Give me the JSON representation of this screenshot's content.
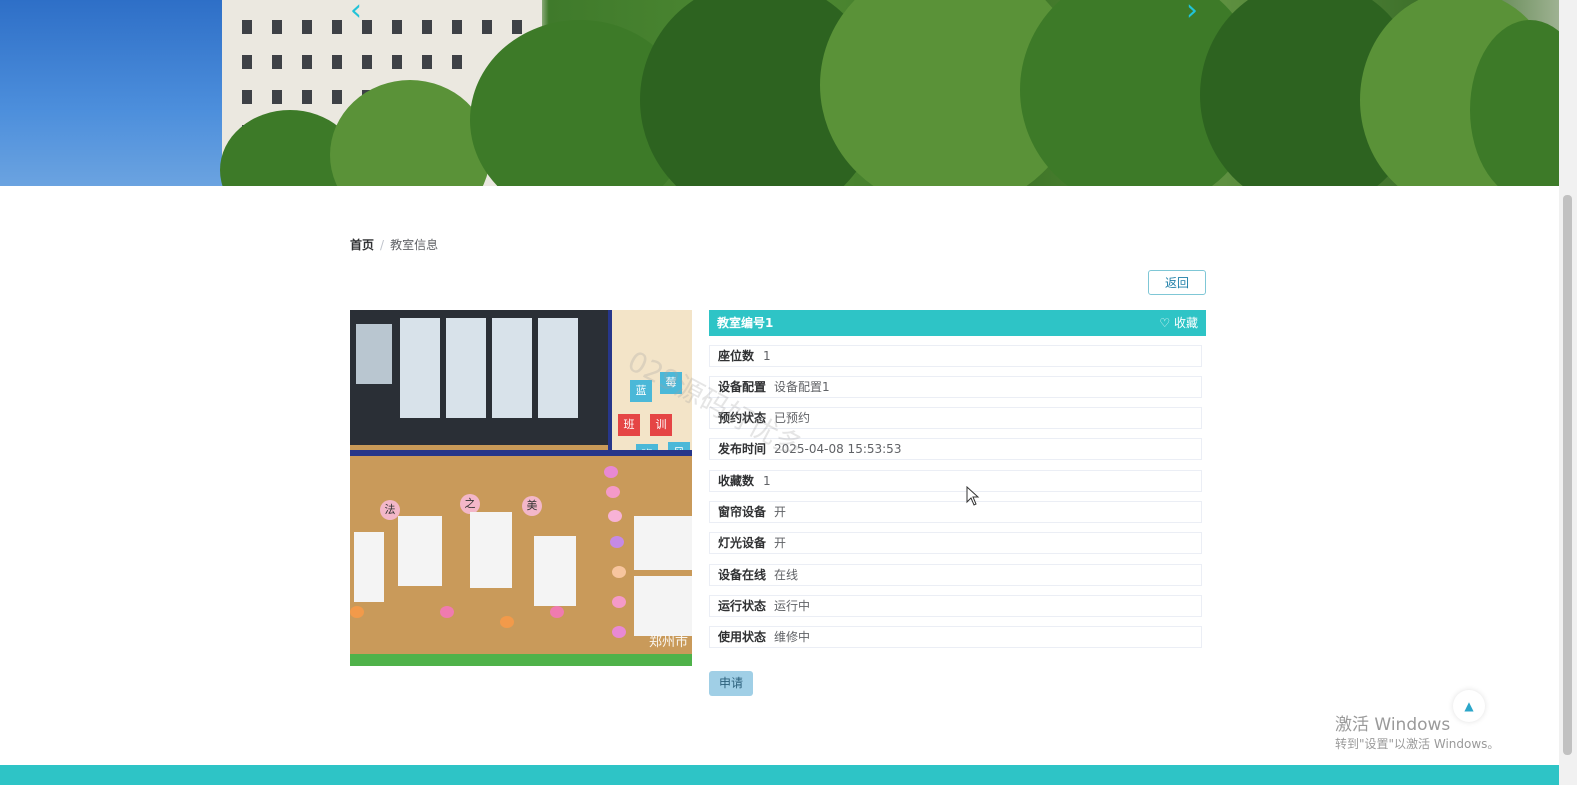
{
  "hero": {
    "prev_icon": "chevron-left-icon",
    "next_icon": "chevron-right-icon"
  },
  "breadcrumb": {
    "home": "首页",
    "separator": "/",
    "current": "教室信息"
  },
  "back_button": "返回",
  "detail": {
    "title": "教室编号1",
    "favorite_icon": "heart-outline-icon",
    "favorite_label": "收藏",
    "rows": [
      {
        "label": "座位数",
        "value": "1"
      },
      {
        "label": "设备配置",
        "value": "设备配置1"
      },
      {
        "label": "预约状态",
        "value": "已预约"
      },
      {
        "label": "发布时间",
        "value": "2025-04-08 15:53:53"
      },
      {
        "label": "收藏数",
        "value": "1"
      },
      {
        "label": "窗帘设备",
        "value": "开"
      },
      {
        "label": "灯光设备",
        "value": "开"
      },
      {
        "label": "设备在线",
        "value": "在线"
      },
      {
        "label": "运行状态",
        "value": "运行中"
      },
      {
        "label": "使用状态",
        "value": "维修中"
      }
    ]
  },
  "apply_button": "申请",
  "photo": {
    "board_chars": [
      "蓝",
      "莓",
      "班",
      "训",
      "班",
      "风"
    ],
    "labels": [
      "法",
      "之",
      "美"
    ],
    "watermark": "郑州市"
  },
  "overlay_watermark": "029源码好优多",
  "back_to_top_icon": "caret-up-icon",
  "os_activation": {
    "title": "激活 Windows",
    "subtitle": "转到\"设置\"以激活 Windows。"
  },
  "colors": {
    "accent": "#2ec4c6",
    "apply_button": "#a0cfe6",
    "back_border": "#7fc7d6"
  }
}
